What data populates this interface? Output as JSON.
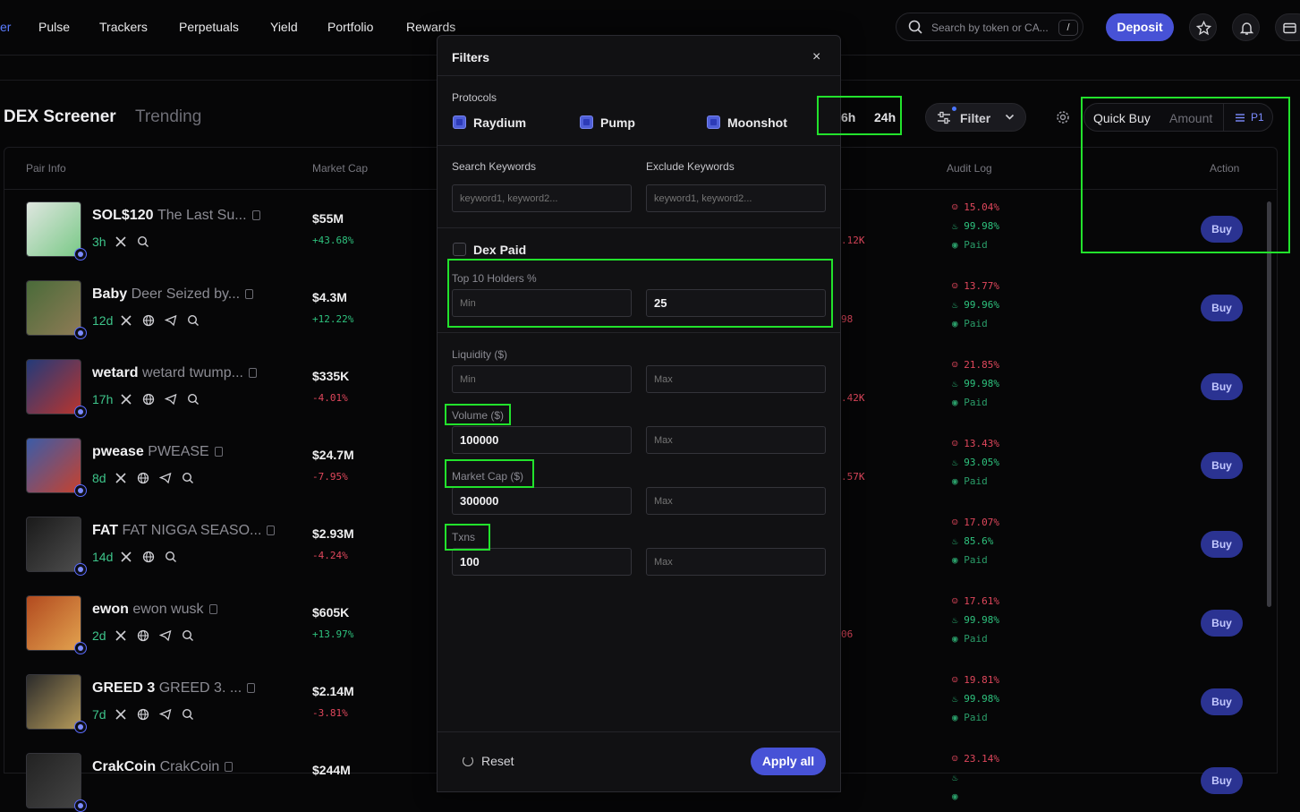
{
  "nav": {
    "partial_left": "er",
    "items": [
      "Pulse",
      "Trackers",
      "Perpetuals",
      "Yield",
      "Portfolio",
      "Rewards"
    ],
    "search_placeholder": "Search by token or CA...",
    "search_shortcut": "/",
    "deposit_label": "Deposit"
  },
  "screener": {
    "title": "DEX Screener",
    "tab_trending": "Trending",
    "timeframes": [
      "6h",
      "24h"
    ],
    "filter_label": "Filter",
    "quick_buy_label": "Quick Buy",
    "amount_placeholder": "Amount",
    "preset_label": "P1"
  },
  "table": {
    "headers": {
      "pair_info": "Pair Info",
      "market_cap": "Market Cap",
      "audit_log": "Audit Log",
      "action": "Action"
    },
    "buy_label": "Buy",
    "rows": [
      {
        "symbol": "SOL$120",
        "name": "The Last Su...",
        "age": "3h",
        "mcap": "$55M",
        "change": "+43.68%",
        "trend": "pos",
        "hidden": ".12K",
        "top10": "15.04%",
        "holders": "99.98%",
        "paid": "Paid",
        "socials": [
          "x",
          "search"
        ]
      },
      {
        "symbol": "Baby",
        "name": "Deer Seized by...",
        "age": "12d",
        "mcap": "$4.3M",
        "change": "+12.22%",
        "trend": "pos",
        "hidden": "98",
        "top10": "13.77%",
        "holders": "99.96%",
        "paid": "Paid",
        "socials": [
          "x",
          "web",
          "tg",
          "search"
        ]
      },
      {
        "symbol": "wetard",
        "name": "wetard twump...",
        "age": "17h",
        "mcap": "$335K",
        "change": "-4.01%",
        "trend": "neg",
        "hidden": ".42K",
        "top10": "21.85%",
        "holders": "99.98%",
        "paid": "Paid",
        "socials": [
          "x",
          "web",
          "tg",
          "search"
        ]
      },
      {
        "symbol": "pwease",
        "name": "PWEASE",
        "age": "8d",
        "mcap": "$24.7M",
        "change": "-7.95%",
        "trend": "neg",
        "hidden": ".57K",
        "top10": "13.43%",
        "holders": "93.05%",
        "paid": "Paid",
        "socials": [
          "x",
          "web",
          "tg",
          "search"
        ]
      },
      {
        "symbol": "FAT",
        "name": "FAT NIGGA SEASO...",
        "age": "14d",
        "mcap": "$2.93M",
        "change": "-4.24%",
        "trend": "neg",
        "hidden": "",
        "top10": "17.07%",
        "holders": "85.6%",
        "paid": "Paid",
        "socials": [
          "x",
          "web",
          "search"
        ]
      },
      {
        "symbol": "ewon",
        "name": "ewon wusk",
        "age": "2d",
        "mcap": "$605K",
        "change": "+13.97%",
        "trend": "pos",
        "hidden": "06",
        "top10": "17.61%",
        "holders": "99.98%",
        "paid": "Paid",
        "socials": [
          "x",
          "web",
          "tg",
          "search"
        ]
      },
      {
        "symbol": "GREED 3",
        "name": "GREED 3. ...",
        "age": "7d",
        "mcap": "$2.14M",
        "change": "-3.81%",
        "trend": "neg",
        "hidden": "",
        "top10": "19.81%",
        "holders": "99.98%",
        "paid": "Paid",
        "socials": [
          "x",
          "web",
          "tg",
          "search"
        ]
      },
      {
        "symbol": "CrakCoin",
        "name": "CrakCoin",
        "age": "",
        "mcap": "$244M",
        "change": "",
        "trend": "pos",
        "hidden": "",
        "top10": "23.14%",
        "holders": "",
        "paid": "",
        "socials": []
      }
    ]
  },
  "filters": {
    "title": "Filters",
    "close": "×",
    "protocols_label": "Protocols",
    "protocols": [
      {
        "label": "Raydium",
        "checked": true
      },
      {
        "label": "Pump",
        "checked": true
      },
      {
        "label": "Moonshot",
        "checked": true
      }
    ],
    "search_keywords_label": "Search Keywords",
    "exclude_keywords_label": "Exclude Keywords",
    "keywords_placeholder": "keyword1, keyword2...",
    "dex_paid_label": "Dex Paid",
    "top10_label": "Top 10 Holders %",
    "top10_min": "",
    "top10_max": "25",
    "liquidity_label": "Liquidity ($)",
    "liquidity_min": "",
    "liquidity_max": "",
    "volume_label": "Volume ($)",
    "volume_min": "100000",
    "volume_max": "",
    "mcap_label": "Market Cap ($)",
    "mcap_min": "300000",
    "mcap_max": "",
    "txns_label": "Txns",
    "txns_min": "100",
    "txns_max": "",
    "min_placeholder": "Min",
    "max_placeholder": "Max",
    "reset_label": "Reset",
    "apply_label": "Apply all"
  },
  "colors": {
    "accent": "#4752d6",
    "positive": "#2ec27e",
    "negative": "#e0475c",
    "highlight": "#22e22c"
  }
}
